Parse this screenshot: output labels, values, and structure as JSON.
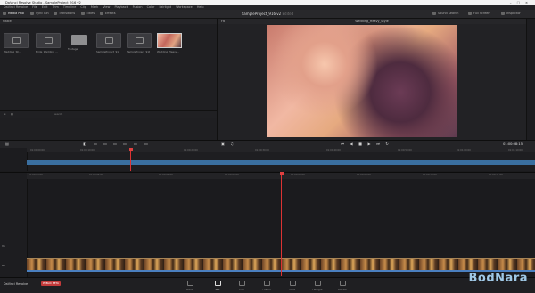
{
  "window": {
    "title": "DaVinci Resolve Studio - SampleProject_916 v2",
    "controls": [
      "–",
      "□",
      "×"
    ]
  },
  "menu": [
    "DaVinci Resolve",
    "File",
    "Edit",
    "Trim",
    "Timeline",
    "Clip",
    "Mark",
    "View",
    "Playback",
    "Fusion",
    "Color",
    "Fairlight",
    "Workspace",
    "Help"
  ],
  "toolbar": {
    "media_pool": "Media Pool",
    "sync_bin": "Sync Bin",
    "transitions": "Transitions",
    "titles": "Titles",
    "effects": "Effects",
    "project_title": "SampleProject_916 v2",
    "edited": "Edited",
    "sound_search": "Sound Search",
    "full_screen": "Full Screen",
    "inspector": "Inspector"
  },
  "media_pool": {
    "bin": "Master",
    "search": "Search",
    "clips": [
      {
        "label": "Wedding_Sh...",
        "kind": "clip"
      },
      {
        "label": "Bride_Wedding_...",
        "kind": "clip"
      },
      {
        "label": "Footage",
        "kind": "folder"
      },
      {
        "label": "SampleProject_916",
        "kind": "clip"
      },
      {
        "label": "SampleProject_916...",
        "kind": "clip"
      },
      {
        "label": "Wedding_Heavy...",
        "kind": "image"
      }
    ]
  },
  "viewer": {
    "clip_name": "Wedding_Heavy_Style",
    "zoom": "Fit"
  },
  "transport": {
    "timecode": "01:00:08:15"
  },
  "upper_timeline": {
    "ticks": [
      "01:00:00:00",
      "01:00:10:00",
      "01:00:20:00",
      "01:00:30:00",
      "01:00:40:00",
      "01:00:50:00",
      "01:01:00:00",
      "01:01:10:00"
    ]
  },
  "lower_timeline": {
    "ticks": [
      "01:00:04:00",
      "01:00:05:00",
      "01:00:06:00",
      "01:00:07:00",
      "01:00:08:00",
      "01:00:09:00",
      "01:00:10:00",
      "01:00:11:00",
      "01:00:12:00",
      "01:00:13:00",
      "01:00:14:00"
    ],
    "tracks": [
      "V1",
      "A1"
    ]
  },
  "pages": [
    {
      "label": "Media",
      "active": false
    },
    {
      "label": "Cut",
      "active": true
    },
    {
      "label": "Edit",
      "active": false
    },
    {
      "label": "Fusion",
      "active": false
    },
    {
      "label": "Color",
      "active": false
    },
    {
      "label": "Fairlight",
      "active": false
    },
    {
      "label": "Deliver",
      "active": false
    }
  ],
  "app_brand": "DaVinci Resolve",
  "beta_badge": "PUBLIC BETA",
  "watermark": "BodNara",
  "colors": {
    "playhead": "#dd3333",
    "track_blue": "#3a6fa0",
    "beta": "#c23a3a"
  }
}
